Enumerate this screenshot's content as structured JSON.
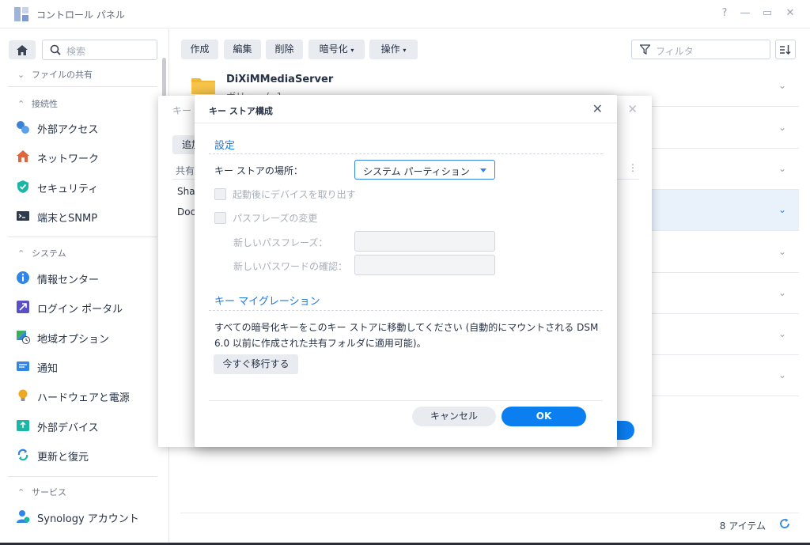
{
  "window": {
    "title": "コントロール パネル",
    "help": "?",
    "minimize": "—",
    "maximize": "▭",
    "close": "✕"
  },
  "sidebar": {
    "search_placeholder": "検索",
    "sections": [
      {
        "label": "ファイルの共有",
        "state": "collapsed"
      },
      {
        "label": "接続性",
        "state": "expanded"
      },
      {
        "label": "システム",
        "state": "expanded"
      },
      {
        "label": "サービス",
        "state": "expanded"
      }
    ],
    "items": [
      {
        "label": "外部アクセス",
        "icon": "external-access-icon"
      },
      {
        "label": "ネットワーク",
        "icon": "network-icon"
      },
      {
        "label": "セキュリティ",
        "icon": "security-shield-icon"
      },
      {
        "label": "端末とSNMP",
        "icon": "terminal-icon"
      },
      {
        "label": "情報センター",
        "icon": "info-icon"
      },
      {
        "label": "ログイン ポータル",
        "icon": "login-portal-icon"
      },
      {
        "label": "地域オプション",
        "icon": "regional-options-icon"
      },
      {
        "label": "通知",
        "icon": "notification-icon"
      },
      {
        "label": "ハードウェアと電源",
        "icon": "hardware-power-icon"
      },
      {
        "label": "外部デバイス",
        "icon": "external-device-icon"
      },
      {
        "label": "更新と復元",
        "icon": "update-restore-icon"
      },
      {
        "label": "Synology アカウント",
        "icon": "synology-account-icon"
      }
    ]
  },
  "toolbar": {
    "create": "作成",
    "edit": "編集",
    "delete": "削除",
    "encrypt": "暗号化",
    "action": "操作",
    "filter_placeholder": "フィルタ"
  },
  "main": {
    "first_row": {
      "name": "DiXiMMediaServer",
      "sub": "ボリューム 1"
    },
    "item_count": "8 アイテム"
  },
  "bg_dialog": {
    "title": "キー",
    "add": "追加",
    "column": "共有",
    "rows": [
      "Sha",
      "Doc"
    ]
  },
  "modal": {
    "title": "キー ストア構成",
    "section_settings": "設定",
    "location_label": "キー ストアの場所：",
    "location_value": "システム パーティション",
    "eject_label": "起動後にデバイスを取り出す",
    "change_pass_label": "パスフレーズの変更",
    "new_pass_label": "新しいパスフレーズ：",
    "confirm_pass_label": "新しいパスワードの確認：",
    "section_migration": "キー マイグレーション",
    "migration_desc": "すべての暗号化キーをこのキー ストアに移動してください (自動的にマウントされる DSM 6.0 以前に作成された共有フォルダに適用可能)。",
    "migrate_button": "今すぐ移行する",
    "cancel": "キャンセル",
    "ok": "OK"
  },
  "colors": {
    "accent": "#0b7ef0",
    "section_title": "#1f7ae0",
    "selected_row": "#e9f1fb"
  }
}
